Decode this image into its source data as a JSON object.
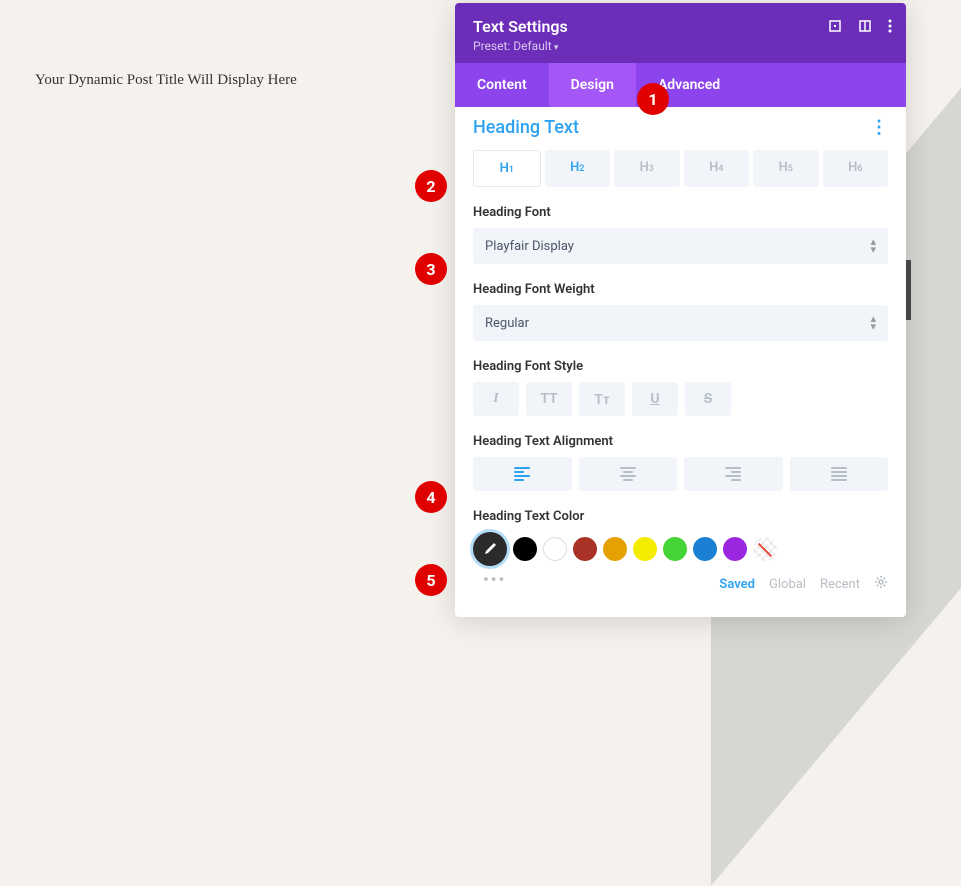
{
  "preview": {
    "title": "Your Dynamic Post Title Will Display Here"
  },
  "panel": {
    "title": "Text Settings",
    "preset": "Preset: Default"
  },
  "tabs": {
    "content": "Content",
    "design": "Design",
    "advanced": "Advanced"
  },
  "section": {
    "title": "Heading Text"
  },
  "heading_levels": {
    "h1": "H",
    "h1s": "1",
    "h2": "H",
    "h2s": "2",
    "h3": "H",
    "h3s": "3",
    "h4": "H",
    "h4s": "4",
    "h5": "H",
    "h5s": "5",
    "h6": "H",
    "h6s": "6"
  },
  "labels": {
    "font": "Heading Font",
    "weight": "Heading Font Weight",
    "style": "Heading Font Style",
    "align": "Heading Text Alignment",
    "color": "Heading Text Color"
  },
  "values": {
    "font": "Playfair Display",
    "weight": "Regular"
  },
  "style_btns": {
    "italic": "I",
    "tt_upper": "TT",
    "tt_small": "Tᴛ",
    "underline": "U",
    "strike": "S"
  },
  "color_scope": {
    "saved": "Saved",
    "global": "Global",
    "recent": "Recent"
  },
  "colors": {
    "black": "#000000",
    "white": "#ffffff",
    "darkred": "#a93226",
    "orange": "#e5a100",
    "yellow": "#f4eb00",
    "green": "#44d435",
    "blue": "#1b7fd4",
    "purple": "#9b27e0"
  },
  "callouts": {
    "c1": "1",
    "c2": "2",
    "c3": "3",
    "c4": "4",
    "c5": "5"
  }
}
